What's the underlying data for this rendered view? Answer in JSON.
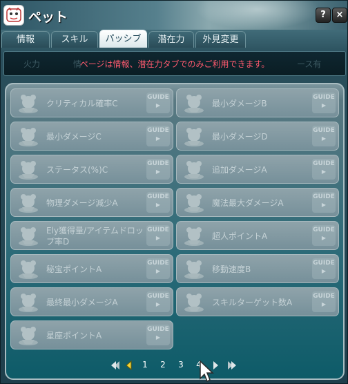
{
  "window": {
    "title": "ペット",
    "help_label": "?",
    "close_label": "×"
  },
  "tabs": [
    {
      "label": "情報"
    },
    {
      "label": "スキル"
    },
    {
      "label": "パッシブ"
    },
    {
      "label": "潜在力"
    },
    {
      "label": "外見変更"
    }
  ],
  "active_tab": "パッシブ",
  "notice": {
    "message": "ページは情報、潜在力タブでのみご利用できます。",
    "ghost_left": "火力",
    "ghost_left2": "情",
    "ghost_right": "ース有"
  },
  "passives": [
    {
      "label": "クリティカル確率C"
    },
    {
      "label": "最小ダメージB"
    },
    {
      "label": "最小ダメージC"
    },
    {
      "label": "最小ダメージD"
    },
    {
      "label": "ステータス(%)C"
    },
    {
      "label": "追加ダメージA"
    },
    {
      "label": "物理ダメージ減少A"
    },
    {
      "label": "魔法最大ダメージA"
    },
    {
      "label": "Ely獲得量/アイテムドロップ率D"
    },
    {
      "label": "超人ポイントA"
    },
    {
      "label": "秘宝ポイントA"
    },
    {
      "label": "移動速度B"
    },
    {
      "label": "最終最小ダメージA"
    },
    {
      "label": "スキルターゲット数A"
    },
    {
      "label": "星座ポイントA"
    }
  ],
  "guide_label": "GUIDE",
  "pagination": {
    "pages": [
      "1",
      "2",
      "3",
      "4"
    ],
    "current_page": "4"
  },
  "icons": {
    "first": "first-page-icon",
    "prev": "prev-page-icon",
    "next": "next-page-icon",
    "last": "last-page-icon",
    "cursor": "mouse-cursor-icon"
  },
  "colors": {
    "notice_text": "#ff5a6e",
    "active_tab_bg": "#ffffff",
    "panel_teal": "#0d5b68"
  }
}
